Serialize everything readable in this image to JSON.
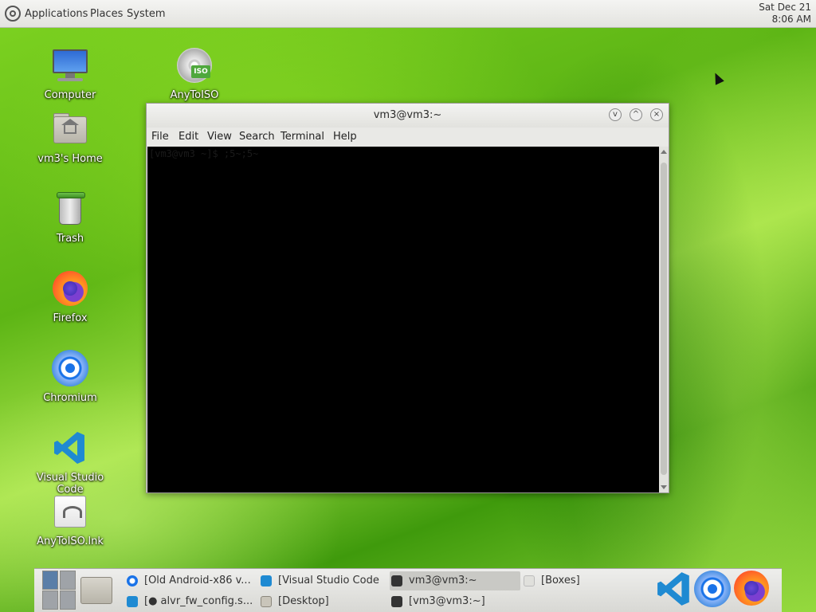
{
  "topbar": {
    "menus": [
      "Applications",
      "Places",
      "System"
    ],
    "clock": {
      "date": "Sat Dec 21",
      "time": "8:06 AM"
    }
  },
  "desktop": {
    "icons": [
      {
        "label": "Computer",
        "icon": "computer-icon"
      },
      {
        "label": "vm3's Home",
        "icon": "home-folder-icon"
      },
      {
        "label": "Trash",
        "icon": "trash-icon"
      },
      {
        "label": "Firefox",
        "icon": "firefox-icon"
      },
      {
        "label": "Chromium",
        "icon": "chromium-icon"
      },
      {
        "label": "Visual Studio Code",
        "icon": "vscode-icon"
      },
      {
        "label": "AnyToISO.lnk",
        "icon": "shortcut-icon"
      },
      {
        "label": "AnyToISO",
        "icon": "disc-iso-icon"
      }
    ],
    "iso_badge": "ISO"
  },
  "terminal_window": {
    "title": "vm3@vm3:~",
    "menu": [
      "File",
      "Edit",
      "View",
      "Search",
      "Terminal",
      "Help"
    ],
    "prompt_text": "[vm3@vm3 ~]$ ;5~;5~",
    "controls": {
      "minimize": "v",
      "maximize": "^",
      "close": "×"
    }
  },
  "taskbar": {
    "tasks": [
      {
        "label": "[Old Android-x86 v...",
        "icon": "chromium-icon"
      },
      {
        "label": "[Visual Studio Code]",
        "icon": "vscode-icon"
      },
      {
        "label": "vm3@vm3:~",
        "icon": "terminal-icon",
        "active": true
      },
      {
        "label": "[Boxes]",
        "icon": "boxes-icon"
      },
      {
        "label": "[● alvr_fw_config.s...",
        "icon": "vscode-icon"
      },
      {
        "label": "[Desktop]",
        "icon": "folder-icon"
      },
      {
        "label": "[vm3@vm3:~]",
        "icon": "terminal-icon"
      }
    ]
  },
  "colors": {
    "terminal_bg": "#000000",
    "vscode_blue": "#1f8ad2",
    "chromium_blue": "#1a73e8"
  }
}
